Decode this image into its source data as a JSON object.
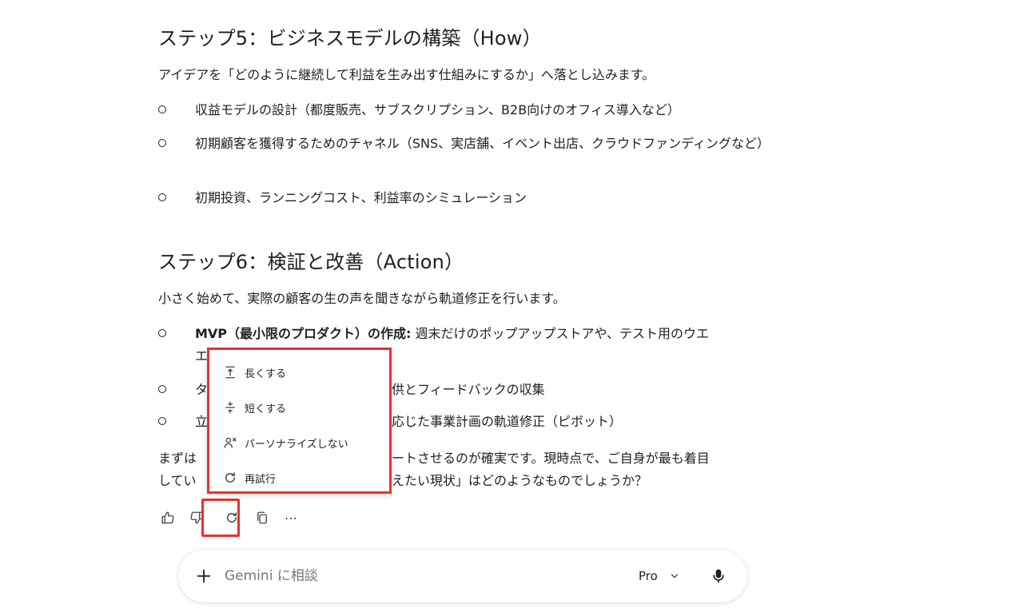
{
  "step5": {
    "heading": "ステップ5：ビジネスモデルの構築（How）",
    "intro": "アイデアを「どのように継続して利益を生み出す仕組みにするか」へ落とし込みます。",
    "bullets": [
      "収益モデルの設計（都度販売、サブスクリプション、B2B向けのオフィス導入など）",
      "初期顧客を獲得するためのチャネル（SNS、実店舗、イベント出店、クラウドファンディングなど）",
      "初期投資、ランニングコスト、利益率のシミュレーション"
    ]
  },
  "step6": {
    "heading": "ステップ6：検証と改善（Action）",
    "intro": "小さく始めて、実際の顧客の生の声を聞きながら軌道修正を行います。",
    "bullet1_bold": "MVP（最小限のプロダクト）の作成:",
    "bullet1_text": " 週末だけのポップアップストアや、テスト用のウエ",
    "bullet2_visible_start": "タ",
    "bullet2_visible_end": "供とフィードバックの収集",
    "bullet3_visible_start": "立",
    "bullet3_visible_end": "応じた事業計画の軌道修正（ピボット）"
  },
  "closing": {
    "line1_start": "まずは",
    "line1_end": "ートさせるのが確実です。現時点で、ご自身が最も着目",
    "line2_start": "してい",
    "line2_end": "えたい現状」はどのようなものでしょうか？"
  },
  "actions": {
    "icons": [
      "thumb-up-icon",
      "thumb-down-icon",
      "redo-icon",
      "copy-icon",
      "more-icon"
    ],
    "more_label": "⋯"
  },
  "menu": {
    "items": [
      {
        "label": "長くする",
        "icon": "expand-icon"
      },
      {
        "label": "短くする",
        "icon": "shorten-icon"
      },
      {
        "label": "パーソナライズしない",
        "icon": "person-off-icon"
      },
      {
        "label": "再試行",
        "icon": "retry-icon"
      }
    ]
  },
  "input": {
    "placeholder": "Gemini に相談",
    "model": "Pro"
  },
  "colors": {
    "highlight": "#e8322f",
    "text": "#1f1f1f",
    "placeholder": "#757575"
  }
}
